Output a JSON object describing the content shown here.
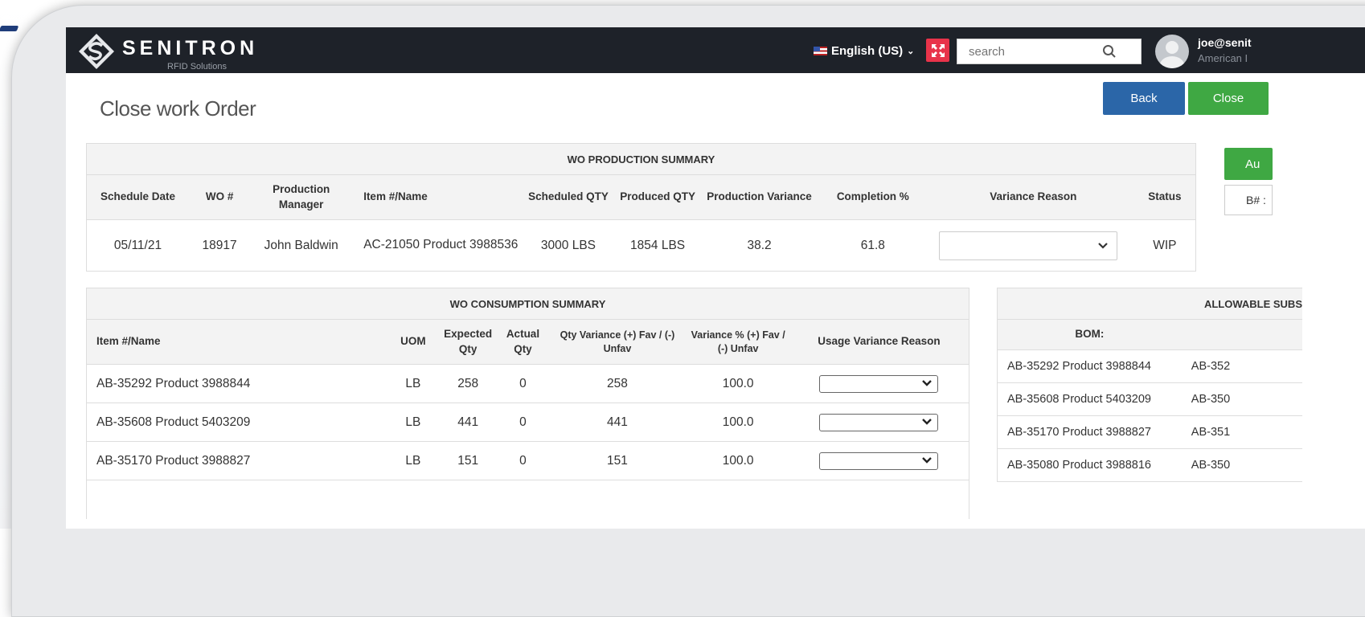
{
  "brand": {
    "name": "SENITRON",
    "tagline": "RFID Solutions"
  },
  "header": {
    "language": "English (US)",
    "search_placeholder": "search",
    "user_email": "joe@senit",
    "user_org": "American I"
  },
  "page": {
    "title": "Close work Order",
    "back_label": "Back",
    "close_label": "Close",
    "auto_label": "Au",
    "b_label": "B# :"
  },
  "production": {
    "title": "WO PRODUCTION SUMMARY",
    "columns": [
      "Schedule Date",
      "WO #",
      "Production Manager",
      "Item #/Name",
      "Scheduled QTY",
      "Produced QTY",
      "Production Variance",
      "Completion %",
      "Variance Reason",
      "Status"
    ],
    "row": {
      "date": "05/11/21",
      "wo": "18917",
      "manager": "John Baldwin",
      "item": "AC-21050 Product 3988536",
      "scheduled": "3000 LBS",
      "produced": "1854 LBS",
      "variance": "38.2",
      "completion": "61.8",
      "reason": "",
      "status": "WIP"
    }
  },
  "consumption": {
    "title": "WO CONSUMPTION SUMMARY",
    "columns": [
      "Item #/Name",
      "UOM",
      "Expected Qty",
      "Actual Qty",
      "Qty Variance (+) Fav / (-) Unfav",
      "Variance % (+) Fav / (-) Unfav",
      "Usage Variance Reason"
    ],
    "rows": [
      {
        "item": "AB-35292 Product 3988844",
        "uom": "LB",
        "expected": "258",
        "actual": "0",
        "qty_var": "258",
        "var_pct": "100.0"
      },
      {
        "item": "AB-35608 Product 5403209",
        "uom": "LB",
        "expected": "441",
        "actual": "0",
        "qty_var": "441",
        "var_pct": "100.0"
      },
      {
        "item": "AB-35170 Product 3988827",
        "uom": "LB",
        "expected": "151",
        "actual": "0",
        "qty_var": "151",
        "var_pct": "100.0"
      }
    ]
  },
  "substitutes": {
    "title": "ALLOWABLE SUBS",
    "bom_label": "BOM:",
    "rows": [
      {
        "bom": "AB-35292 Product 3988844",
        "sub": "AB-352"
      },
      {
        "bom": "AB-35608 Product 5403209",
        "sub": "AB-350"
      },
      {
        "bom": "AB-35170 Product 3988827",
        "sub": "AB-351"
      },
      {
        "bom": "AB-35080 Product 3988816",
        "sub": "AB-350"
      }
    ]
  },
  "colors": {
    "topbar": "#1e2229",
    "back": "#2b66a8",
    "close": "#3fa843",
    "alert": "#e8334a"
  }
}
